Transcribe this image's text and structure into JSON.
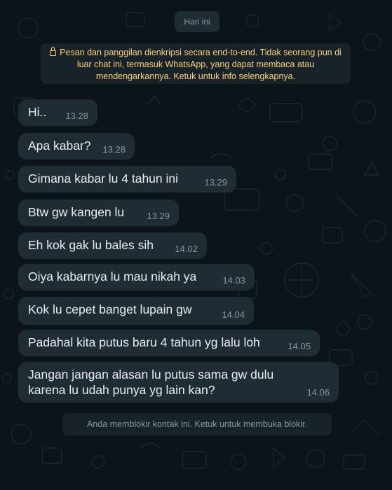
{
  "date_chip": "Hari ini",
  "encryption_notice": "Pesan dan panggilan dienkripsi secara end-to-end. Tidak seorang pun di luar chat ini, termasuk WhatsApp, yang dapat membaca atau mendengarkannya. Ketuk untuk info selengkapnya.",
  "messages": [
    {
      "text": "Hi..",
      "time": "13.28"
    },
    {
      "text": "Apa kabar?",
      "time": "13.28"
    },
    {
      "text": "Gimana kabar lu 4 tahun ini",
      "time": "13.29"
    },
    {
      "text": "Btw gw kangen lu",
      "time": "13.29"
    },
    {
      "text": "Eh kok gak lu bales sih",
      "time": "14.02"
    },
    {
      "text": "Oiya kabarnya lu mau nikah ya",
      "time": "14.03"
    },
    {
      "text": "Kok lu cepet banget lupain gw",
      "time": "14.04"
    },
    {
      "text": "Padahal kita putus baru 4 tahun yg lalu loh",
      "time": "14.05"
    },
    {
      "text": "Jangan jangan alasan lu putus sama gw dulu karena lu udah punya yg lain kan?",
      "time": "14.06"
    }
  ],
  "blocked_note": "Anda memblokir kontak ini. Ketuk untuk membuka blokir.",
  "colors": {
    "background": "#0b1419",
    "bubble": "#202c33",
    "notice_text": "#ffd279",
    "timestamp": "#8696a0"
  },
  "icons": {
    "encryption": "lock-icon"
  }
}
